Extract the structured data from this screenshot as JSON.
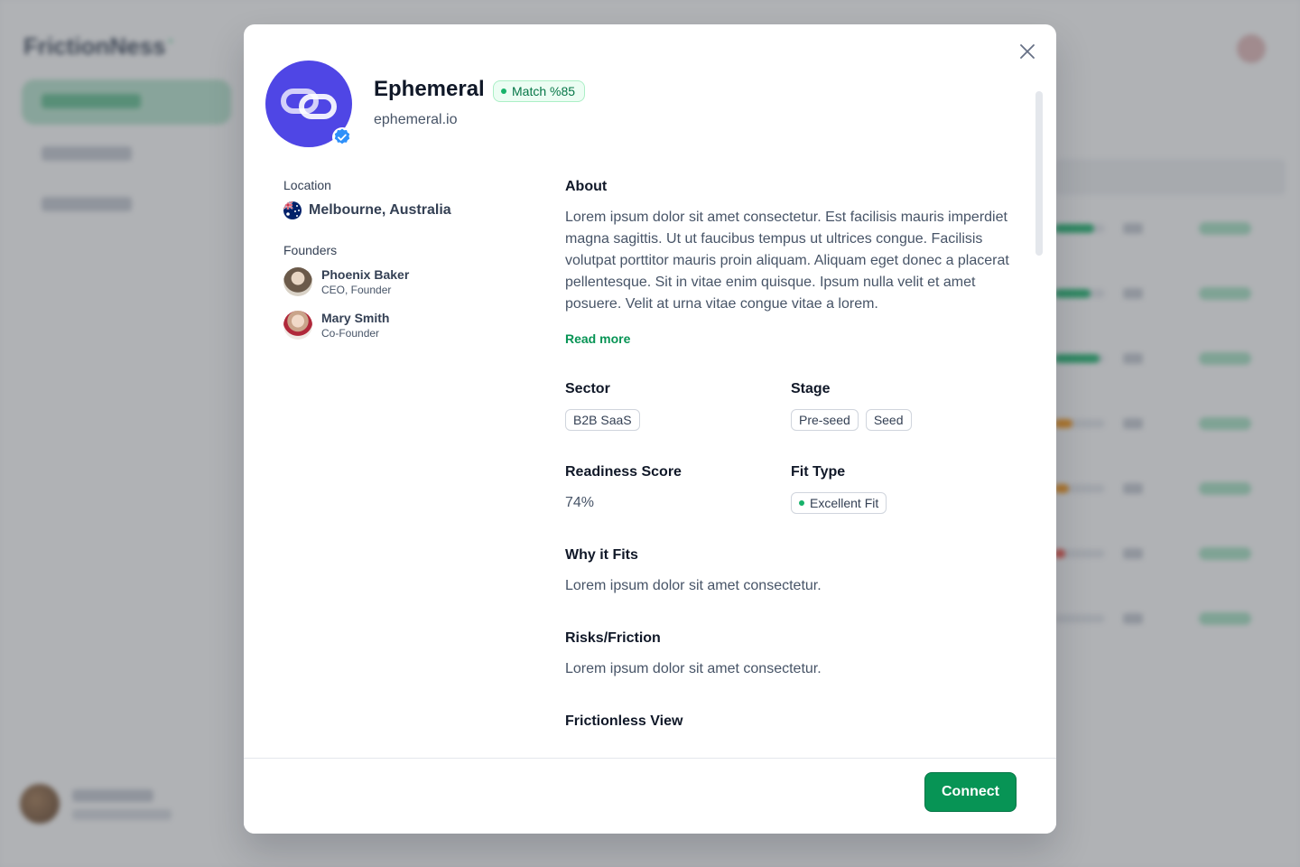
{
  "background": {
    "logo": "FrictionNess"
  },
  "modal": {
    "company": {
      "name": "Ephemeral",
      "url": "ephemeral.io",
      "logo_icon": "link-chain-icon",
      "verified_icon": "verified-badge-icon",
      "match_badge": "Match %85"
    },
    "location": {
      "label": "Location",
      "value": "Melbourne, Australia",
      "flag_icon": "australia-flag-icon"
    },
    "founders": {
      "label": "Founders",
      "items": [
        {
          "name": "Phoenix Baker",
          "role": "CEO, Founder"
        },
        {
          "name": "Mary Smith",
          "role": "Co-Founder"
        }
      ]
    },
    "about": {
      "title": "About",
      "text": "Lorem ipsum dolor sit amet consectetur. Est facilisis mauris imperdiet magna sagittis. Ut ut faucibus tempus ut ultrices congue. Facilisis volutpat porttitor mauris proin aliquam. Aliquam eget donec a placerat pellentesque. Sit in vitae enim quisque. Ipsum nulla velit et amet posuere. Velit at urna vitae congue vitae a lorem.",
      "read_more": "Read more"
    },
    "sector": {
      "title": "Sector",
      "tags": [
        "B2B SaaS"
      ]
    },
    "stage": {
      "title": "Stage",
      "tags": [
        "Pre-seed",
        "Seed"
      ]
    },
    "readiness": {
      "title": "Readiness Score",
      "value": "74%"
    },
    "fit_type": {
      "title": "Fit Type",
      "value": "Excellent Fit"
    },
    "why_fits": {
      "title": "Why it Fits",
      "text": "Lorem ipsum dolor sit amet consectetur."
    },
    "risks": {
      "title": "Risks/Friction",
      "text": "Lorem ipsum dolor sit amet consectetur."
    },
    "frictionless_view": {
      "title": "Frictionless View"
    },
    "connect_label": "Connect",
    "close_icon": "close-icon"
  },
  "colors": {
    "accent": "#079455",
    "logo_bg": "#4f46e5",
    "verified": "#2e90fa"
  }
}
